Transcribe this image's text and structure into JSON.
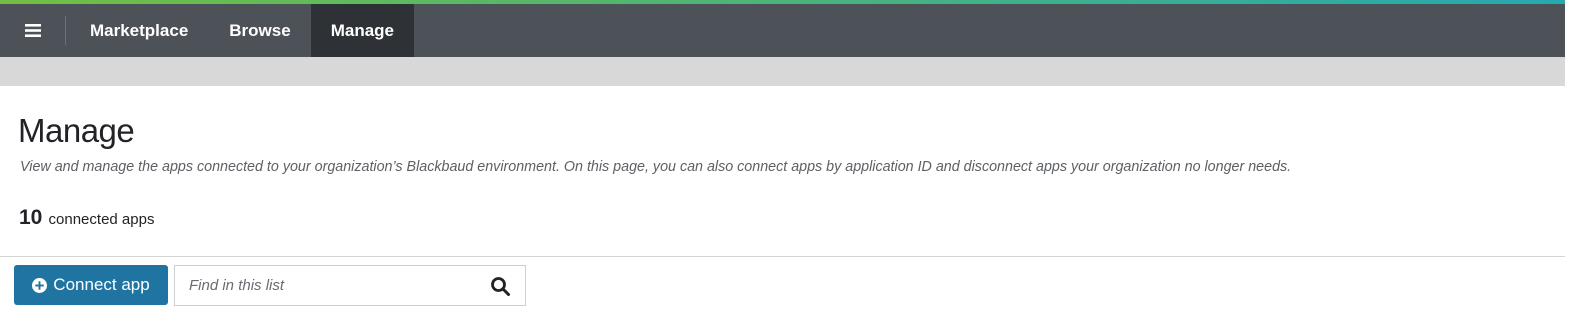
{
  "colors": {
    "navbar_bg": "#4d5259",
    "active_tab_bg": "#2e3135",
    "accent_gradient_start": "#71bf43",
    "accent_gradient_end": "#26a8b1",
    "primary_button": "#1f74a1",
    "subbar_bg": "#d8d8d8"
  },
  "navbar": {
    "menu_icon": "hamburger-menu-icon",
    "brand": "Marketplace",
    "tabs": [
      {
        "label": "Browse",
        "active": false
      },
      {
        "label": "Manage",
        "active": true
      }
    ]
  },
  "page": {
    "title": "Manage",
    "description": "View and manage the apps connected to your organization’s Blackbaud environment. On this page, you can also connect apps by application ID and disconnect apps your organization no longer needs.",
    "count": "10",
    "count_label": "connected apps"
  },
  "toolbar": {
    "connect_label": "Connect app",
    "connect_icon": "plus-circle-icon",
    "search_placeholder": "Find in this list",
    "search_value": "",
    "search_icon": "search-icon"
  }
}
